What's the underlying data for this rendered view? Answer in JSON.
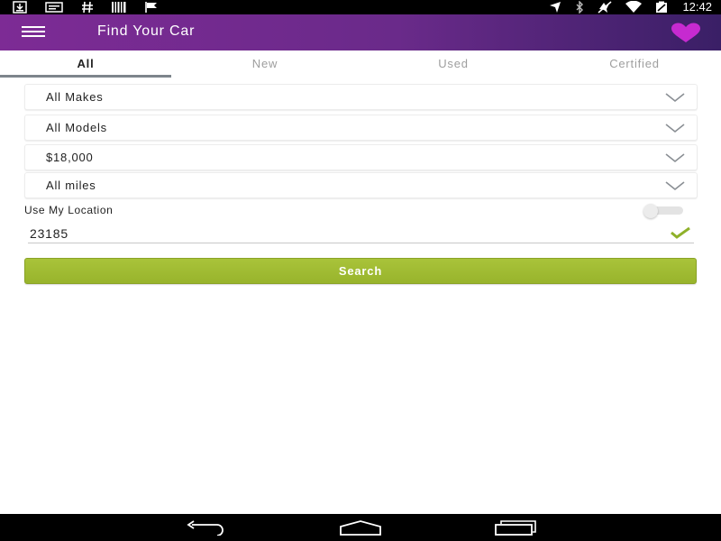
{
  "status_bar": {
    "time": "12:42",
    "left_icons": [
      "download-icon",
      "message-icon",
      "hash-icon",
      "barcode-icon",
      "flag-icon"
    ],
    "right_icons": [
      "location-icon",
      "bluetooth-icon",
      "mute-icon",
      "wifi-icon",
      "battery-icon"
    ]
  },
  "app_bar": {
    "title": "Find Your Car",
    "menu_icon": "hamburger-menu-icon",
    "favorites_icon": "heart-icon",
    "favorites_color": "#c62ad0"
  },
  "tabs": [
    {
      "label": "All",
      "active": true
    },
    {
      "label": "New",
      "active": false
    },
    {
      "label": "Used",
      "active": false
    },
    {
      "label": "Certified",
      "active": false
    }
  ],
  "filters": {
    "make": "All Makes",
    "model": "All Models",
    "price": "$18,000",
    "mileage": "All miles"
  },
  "location": {
    "label": "Use My Location",
    "toggle_on": false,
    "zip": "23185",
    "valid_icon": "checkmark-icon"
  },
  "search_button": {
    "label": "Search",
    "color": "#a2bc33"
  },
  "nav_bar": {
    "icons": [
      "back-icon",
      "home-icon",
      "recent-apps-icon"
    ]
  },
  "colors": {
    "app_bar_start": "#7d2b95",
    "app_bar_end": "#3a1f66",
    "accent_green": "#a2bc33",
    "tab_indicator": "#7d858c"
  }
}
